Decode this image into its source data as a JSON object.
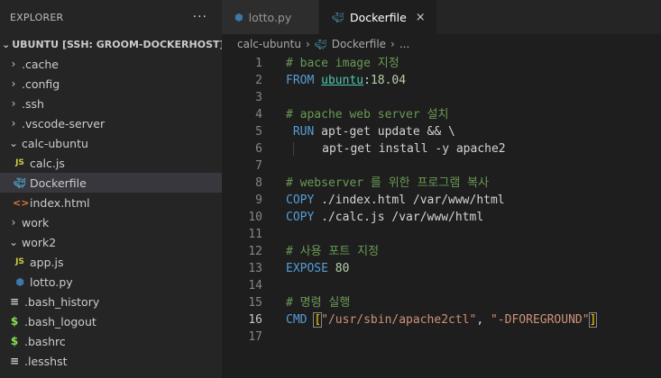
{
  "sidebar": {
    "title": "EXPLORER",
    "more": "···",
    "section": "UBUNTU [SSH: GROOM-DOCKERHOST]",
    "items": [
      {
        "label": ".cache",
        "twisty": "›",
        "depth": 1
      },
      {
        "label": ".config",
        "twisty": "›",
        "depth": 1
      },
      {
        "label": ".ssh",
        "twisty": "›",
        "depth": 1
      },
      {
        "label": ".vscode-server",
        "twisty": "›",
        "depth": 1
      },
      {
        "label": "calc-ubuntu",
        "twisty": "⌄",
        "depth": 1
      },
      {
        "label": "calc.js",
        "icon": "JS",
        "depth": 2
      },
      {
        "label": "Dockerfile",
        "icon": "docker",
        "depth": 2,
        "selected": true
      },
      {
        "label": "index.html",
        "icon": "<>",
        "depth": 2
      },
      {
        "label": "work",
        "twisty": "›",
        "depth": 1
      },
      {
        "label": "work2",
        "twisty": "⌄",
        "depth": 1
      },
      {
        "label": "app.js",
        "icon": "JS",
        "depth": 2
      },
      {
        "label": "lotto.py",
        "icon": "python",
        "depth": 2
      },
      {
        "label": ".bash_history",
        "icon": "≡",
        "depth": 1
      },
      {
        "label": ".bash_logout",
        "icon": "$",
        "depth": 1
      },
      {
        "label": ".bashrc",
        "icon": "$",
        "depth": 1
      },
      {
        "label": ".lesshst",
        "icon": "≡",
        "depth": 1
      }
    ]
  },
  "tabs": [
    {
      "label": "lotto.py",
      "icon": "python",
      "active": false
    },
    {
      "label": "Dockerfile",
      "icon": "docker",
      "active": true,
      "close": "×"
    }
  ],
  "breadcrumb": {
    "folder": "calc-ubuntu",
    "file": "Dockerfile",
    "ellipsis": "..."
  },
  "code": {
    "current_line": 16,
    "lines": [
      {
        "n": "1",
        "text": "# bace image 지정"
      },
      {
        "n": "2",
        "text": "FROM ubuntu:18.04"
      },
      {
        "n": "3",
        "text": ""
      },
      {
        "n": "4",
        "text": "# apache web server 설치"
      },
      {
        "n": "5",
        "text": " RUN apt-get update && \\"
      },
      {
        "n": "6",
        "text": "     apt-get install -y apache2"
      },
      {
        "n": "7",
        "text": ""
      },
      {
        "n": "8",
        "text": "# webserver 를 위한 프로그램 복사"
      },
      {
        "n": "9",
        "text": "COPY ./index.html /var/www/html"
      },
      {
        "n": "10",
        "text": "COPY ./calc.js /var/www/html"
      },
      {
        "n": "11",
        "text": ""
      },
      {
        "n": "12",
        "text": "# 사용 포트 지정"
      },
      {
        "n": "13",
        "text": "EXPOSE 80"
      },
      {
        "n": "14",
        "text": ""
      },
      {
        "n": "15",
        "text": "# 명령 실행"
      },
      {
        "n": "16",
        "text": "CMD [\"/usr/sbin/apache2ctl\", \"-DFOREGROUND\"]"
      },
      {
        "n": "17",
        "text": ""
      }
    ]
  }
}
